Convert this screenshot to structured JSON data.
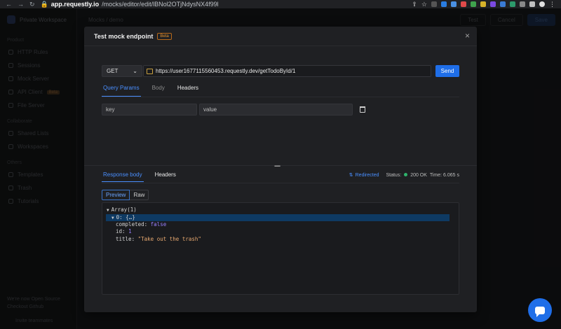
{
  "browser": {
    "url_host": "app.requestly.io",
    "url_path": "/mocks/editor/edit/lBNol2OTjNdysNX4f99l"
  },
  "background_app": {
    "workspace": "Private Workspace",
    "sidebar_sections": [
      {
        "title": "Product",
        "items": [
          "HTTP Rules",
          "Sessions",
          "Mock Server",
          "API Client",
          "File Server"
        ]
      },
      {
        "title": "Collaborate",
        "items": [
          "Shared Lists",
          "Workspaces"
        ]
      },
      {
        "title": "Others",
        "items": [
          "Templates",
          "Trash",
          "Tutorials"
        ]
      }
    ],
    "api_client_badge": "Beta",
    "footer_line1": "We're now Open Source",
    "footer_line2": "Checkout Github",
    "invite": "Invite teammates",
    "breadcrumb": "Mocks / demo",
    "buttons": {
      "test": "Test",
      "cancel": "Cancel",
      "save": "Save"
    }
  },
  "modal": {
    "title": "Test mock endpoint",
    "badge": "Beta",
    "close": "×"
  },
  "request": {
    "method": "GET",
    "url": "https://user1677115560453.requestly.dev/getTodoById/1",
    "send_label": "Send"
  },
  "request_tabs": [
    "Query Params",
    "Body",
    "Headers"
  ],
  "query_param": {
    "key_placeholder": "key",
    "value_placeholder": "value"
  },
  "response": {
    "tabs": [
      "Response body",
      "Headers"
    ],
    "redirected": "Redirected",
    "status_label": "Status:",
    "status_value": "200 OK",
    "time_label": "Time:",
    "time_value": "6.065 s",
    "view_modes": [
      "Preview",
      "Raw"
    ],
    "tree": {
      "root": "Array(1)",
      "item": "0: {…}",
      "fields": [
        {
          "key": "completed:",
          "value": "false",
          "type": "bool"
        },
        {
          "key": "id:",
          "value": "1",
          "type": "num"
        },
        {
          "key": "title:",
          "value": "\"Take out the trash\"",
          "type": "str"
        }
      ]
    }
  }
}
